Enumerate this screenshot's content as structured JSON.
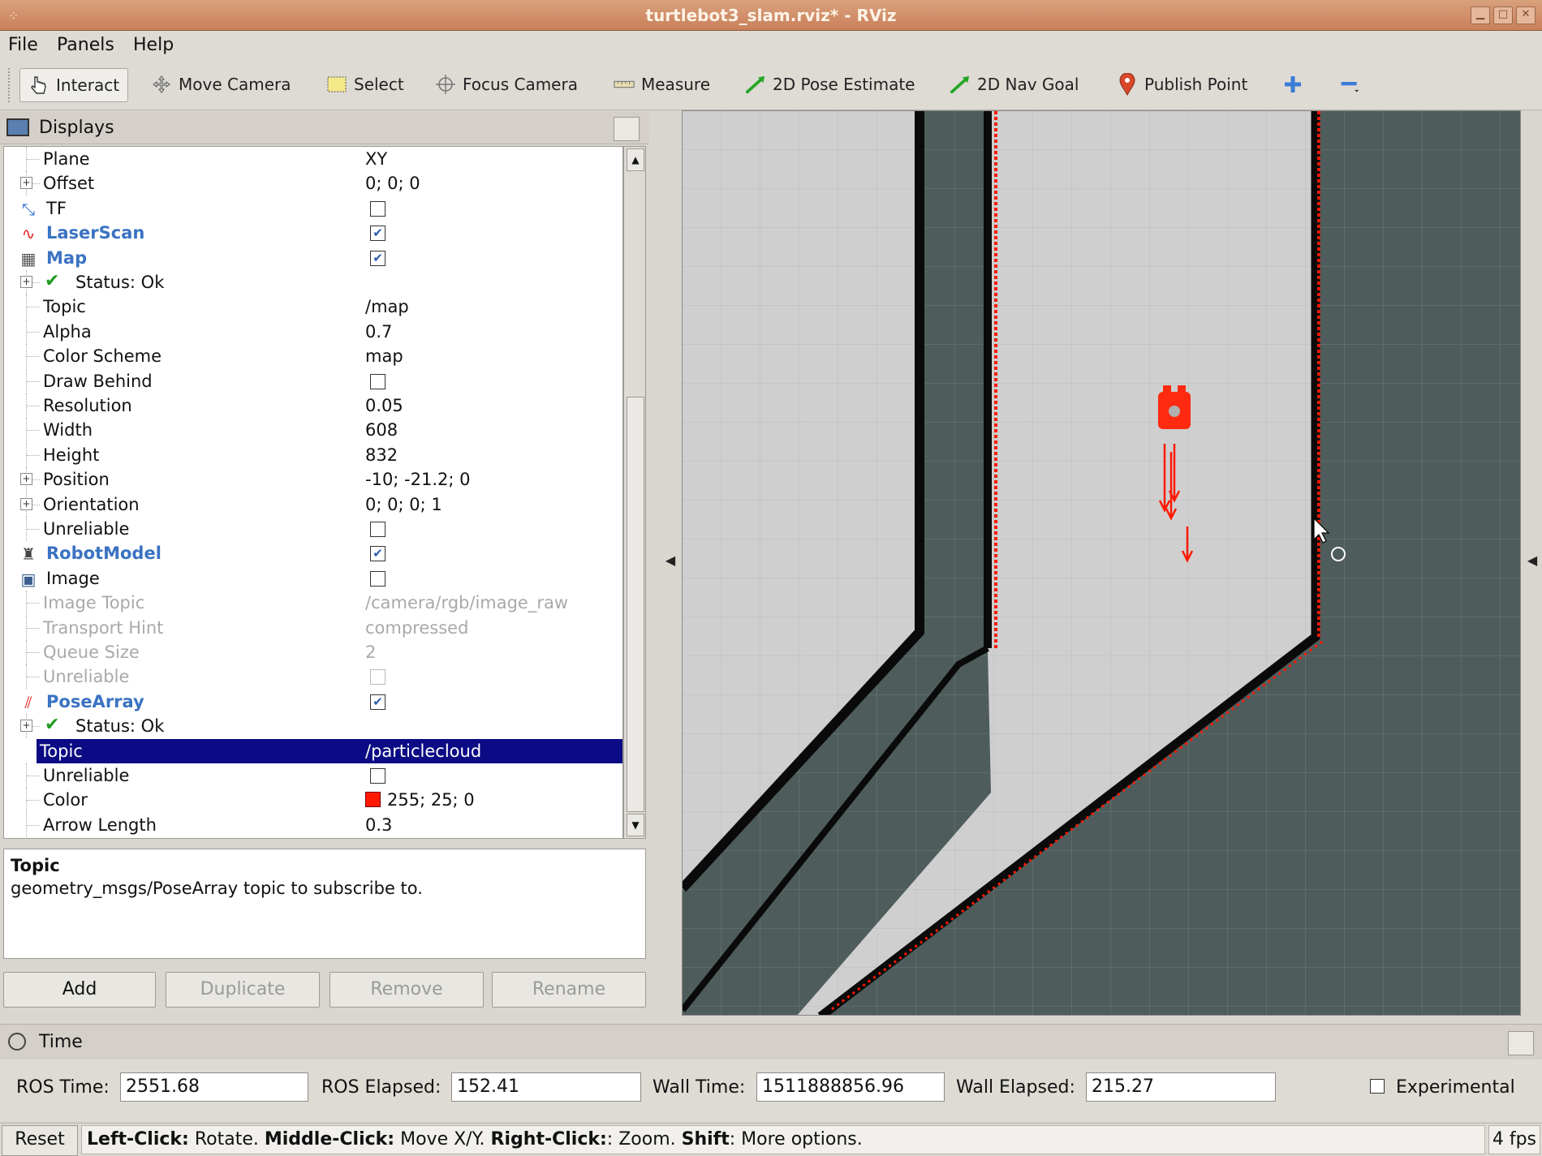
{
  "window": {
    "title": "turtlebot3_slam.rviz* - RViz"
  },
  "menu": {
    "items": [
      "File",
      "Panels",
      "Help"
    ]
  },
  "toolbar": {
    "tools": [
      {
        "label": "Interact",
        "icon": "interact-icon",
        "active": true
      },
      {
        "label": "Move Camera",
        "icon": "move-camera-icon"
      },
      {
        "label": "Select",
        "icon": "select-icon"
      },
      {
        "label": "Focus Camera",
        "icon": "focus-camera-icon"
      },
      {
        "label": "Measure",
        "icon": "measure-icon"
      },
      {
        "label": "2D Pose Estimate",
        "icon": "pose-estimate-icon"
      },
      {
        "label": "2D Nav Goal",
        "icon": "nav-goal-icon"
      },
      {
        "label": "Publish Point",
        "icon": "publish-point-icon"
      }
    ]
  },
  "displays": {
    "title": "Displays",
    "rows": [
      {
        "name": "Plane",
        "value": "XY",
        "indent": 1
      },
      {
        "name": "Offset",
        "value": "0; 0; 0",
        "indent": 1,
        "expander": true
      },
      {
        "name": "TF",
        "checkbox": false,
        "indent": 0,
        "icon": "tf-icon"
      },
      {
        "name": "LaserScan",
        "checkbox": true,
        "indent": 0,
        "group": true,
        "icon": "laserscan-icon"
      },
      {
        "name": "Map",
        "checkbox": true,
        "indent": 0,
        "group": true,
        "icon": "map-icon"
      },
      {
        "name": "Status: Ok",
        "value": "",
        "indent": 1,
        "expander": true,
        "status": true
      },
      {
        "name": "Topic",
        "value": "/map",
        "indent": 1
      },
      {
        "name": "Alpha",
        "value": "0.7",
        "indent": 1
      },
      {
        "name": "Color Scheme",
        "value": "map",
        "indent": 1
      },
      {
        "name": "Draw Behind",
        "checkbox": false,
        "indent": 1
      },
      {
        "name": "Resolution",
        "value": "0.05",
        "indent": 1
      },
      {
        "name": "Width",
        "value": "608",
        "indent": 1
      },
      {
        "name": "Height",
        "value": "832",
        "indent": 1
      },
      {
        "name": "Position",
        "value": "-10; -21.2; 0",
        "indent": 1,
        "expander": true
      },
      {
        "name": "Orientation",
        "value": "0; 0; 0; 1",
        "indent": 1,
        "expander": true
      },
      {
        "name": "Unreliable",
        "checkbox": false,
        "indent": 1
      },
      {
        "name": "RobotModel",
        "checkbox": true,
        "indent": 0,
        "group": true,
        "icon": "robotmodel-icon"
      },
      {
        "name": "Image",
        "checkbox": false,
        "indent": 0,
        "icon": "image-icon"
      },
      {
        "name": "Image Topic",
        "value": "/camera/rgb/image_raw",
        "indent": 1,
        "disabled": true
      },
      {
        "name": "Transport Hint",
        "value": "compressed",
        "indent": 1,
        "disabled": true
      },
      {
        "name": "Queue Size",
        "value": "2",
        "indent": 1,
        "disabled": true
      },
      {
        "name": "Unreliable",
        "checkbox": false,
        "indent": 1,
        "disabled": true
      },
      {
        "name": "PoseArray",
        "checkbox": true,
        "indent": 0,
        "group": true,
        "icon": "posearray-icon"
      },
      {
        "name": "Status: Ok",
        "value": "",
        "indent": 1,
        "expander": true,
        "status": true
      },
      {
        "name": "Topic",
        "value": "/particlecloud",
        "indent": 1,
        "selected": true
      },
      {
        "name": "Unreliable",
        "checkbox": false,
        "indent": 1
      },
      {
        "name": "Color",
        "value": "255; 25; 0",
        "indent": 1,
        "swatch": "#ff1900"
      },
      {
        "name": "Arrow Length",
        "value": "0.3",
        "indent": 1
      }
    ],
    "description": {
      "title": "Topic",
      "text": "geometry_msgs/PoseArray topic to subscribe to."
    },
    "buttons": {
      "add": "Add",
      "duplicate": "Duplicate",
      "remove": "Remove",
      "rename": "Rename"
    }
  },
  "time": {
    "title": "Time",
    "ros_time_label": "ROS Time:",
    "ros_time": "2551.68",
    "ros_elapsed_label": "ROS Elapsed:",
    "ros_elapsed": "152.41",
    "wall_time_label": "Wall Time:",
    "wall_time": "1511888856.96",
    "wall_elapsed_label": "Wall Elapsed:",
    "wall_elapsed": "215.27",
    "experimental_label": "Experimental"
  },
  "status": {
    "reset": "Reset",
    "hint_parts": [
      {
        "b": "Left-Click:",
        "t": " Rotate. "
      },
      {
        "b": "Middle-Click:",
        "t": " Move X/Y. "
      },
      {
        "b": "Right-Click:",
        "t": ": Zoom. "
      },
      {
        "b": "Shift",
        "t": ": More options."
      }
    ],
    "fps": "4 fps"
  },
  "colors": {
    "title_bar": "#c9805a",
    "selection": "#0b0b85",
    "group_text": "#3a73c2",
    "map_free": "#cfcfcf",
    "map_unknown": "#4f5c5c",
    "laser": "#ff1900"
  }
}
